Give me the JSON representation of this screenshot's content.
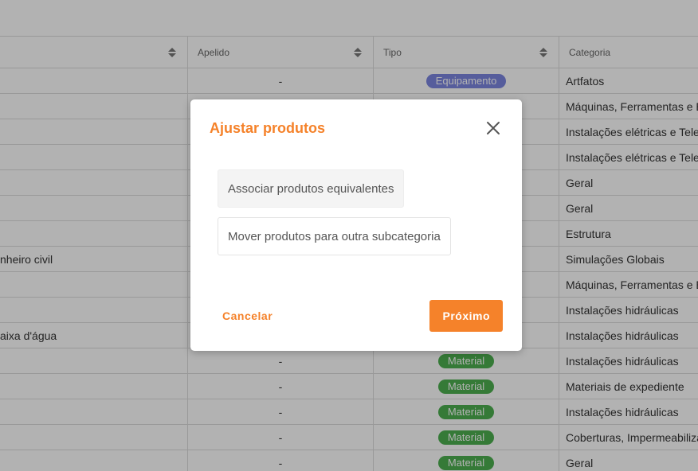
{
  "table": {
    "headers": {
      "col1": "",
      "col2": "Apelido",
      "col3": "Tipo",
      "col4": "Categoria"
    },
    "rows": [
      {
        "name": "",
        "alias": "-",
        "type": "Equipamento",
        "type_color": "#7b86e0",
        "category": "Artfatos"
      },
      {
        "name": "",
        "alias": "",
        "type": "",
        "type_color": "",
        "category": "Máquinas, Ferramentas e Equipamentos"
      },
      {
        "name": "",
        "alias": "",
        "type": "",
        "type_color": "",
        "category": "Instalações elétricas e Telecomunicações"
      },
      {
        "name": "",
        "alias": "",
        "type": "",
        "type_color": "",
        "category": "Instalações elétricas e Telecomunicações"
      },
      {
        "name": "",
        "alias": "",
        "type": "",
        "type_color": "",
        "category": "Geral"
      },
      {
        "name": "",
        "alias": "",
        "type": "",
        "type_color": "",
        "category": "Geral"
      },
      {
        "name": "",
        "alias": "",
        "type": "",
        "type_color": "",
        "category": "Estrutura"
      },
      {
        "name": "nheiro civil",
        "alias": "",
        "type": "",
        "type_color": "",
        "category": "Simulações Globais"
      },
      {
        "name": "",
        "alias": "",
        "type": "",
        "type_color": "",
        "category": "Máquinas, Ferramentas e Equipamentos"
      },
      {
        "name": "",
        "alias": "",
        "type": "",
        "type_color": "",
        "category": "Instalações hidráulicas"
      },
      {
        "name": "aixa d'água",
        "alias": "",
        "type": "",
        "type_color": "",
        "category": "Instalações hidráulicas"
      },
      {
        "name": "",
        "alias": "-",
        "type": "Material",
        "type_color": "#4caf50",
        "category": "Instalações hidráulicas"
      },
      {
        "name": "",
        "alias": "-",
        "type": "Material",
        "type_color": "#4caf50",
        "category": "Materiais de expediente"
      },
      {
        "name": "",
        "alias": "-",
        "type": "Material",
        "type_color": "#4caf50",
        "category": "Instalações hidráulicas"
      },
      {
        "name": "",
        "alias": "-",
        "type": "Material",
        "type_color": "#4caf50",
        "category": "Coberturas, Impermeabilizações"
      },
      {
        "name": "",
        "alias": "-",
        "type": "Material",
        "type_color": "#4caf50",
        "category": "Geral"
      }
    ]
  },
  "modal": {
    "title": "Ajustar produtos",
    "options": [
      {
        "label": "Associar produtos equivalentes",
        "selected": true
      },
      {
        "label": "Mover produtos para outra subcategoria",
        "selected": false
      }
    ],
    "cancel_label": "Cancelar",
    "next_label": "Próximo"
  },
  "colors": {
    "accent": "#f5822a",
    "equipment_badge": "#7b86e0",
    "material_badge": "#4caf50"
  }
}
